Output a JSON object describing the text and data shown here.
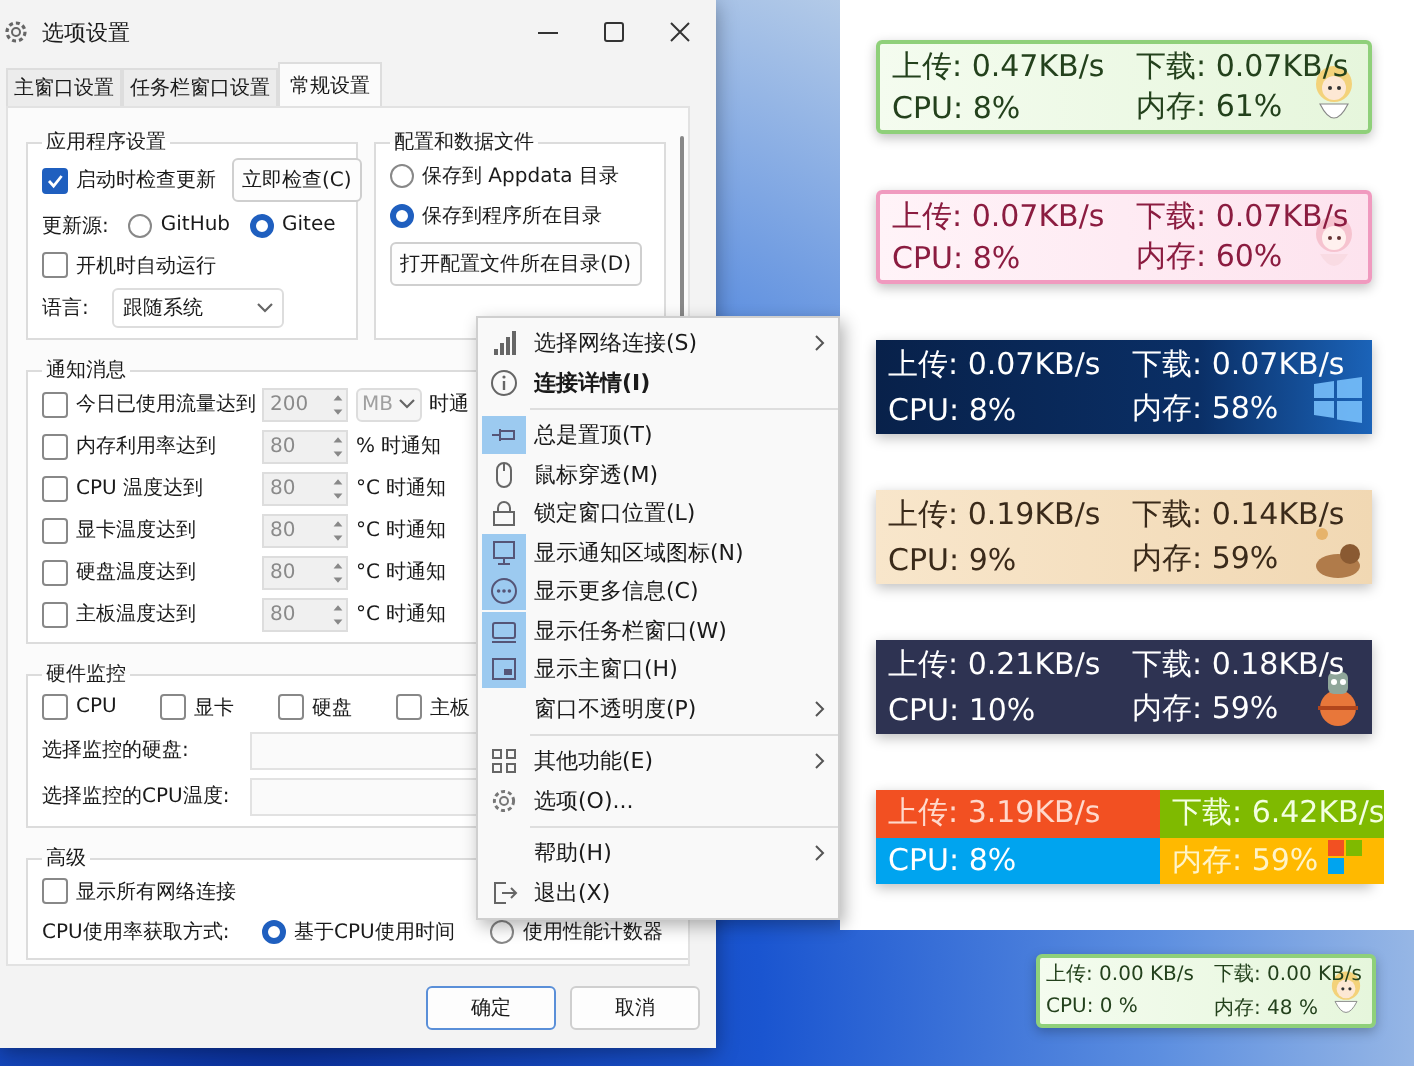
{
  "dialog": {
    "title": "选项设置",
    "tabs": [
      {
        "label": "主窗口设置",
        "selected": false
      },
      {
        "label": "任务栏窗口设置",
        "selected": false
      },
      {
        "label": "常规设置",
        "selected": true
      }
    ],
    "app_settings": {
      "title": "应用程序设置",
      "check_update": {
        "label": "启动时检查更新",
        "checked": true
      },
      "check_now_button": "立即检查(C)",
      "update_source": {
        "label": "更新源:",
        "options": [
          {
            "label": "GitHub",
            "selected": false
          },
          {
            "label": "Gitee",
            "selected": true
          }
        ]
      },
      "autostart": {
        "label": "开机时自动运行",
        "checked": false
      },
      "language": {
        "label": "语言:",
        "value": "跟随系统"
      }
    },
    "config_files": {
      "title": "配置和数据文件",
      "options": [
        {
          "label": "保存到 Appdata 目录",
          "selected": false
        },
        {
          "label": "保存到程序所在目录",
          "selected": true
        }
      ],
      "open_button": "打开配置文件所在目录(D)"
    },
    "notifications": {
      "title": "通知消息",
      "rows": [
        {
          "kind": "dropdown",
          "label": "今日已使用流量达到",
          "checked": false,
          "value": "200",
          "unit": "MB",
          "suffix": "时通"
        },
        {
          "kind": "text",
          "label": "内存利用率达到",
          "checked": false,
          "value": "80",
          "unit": "%",
          "suffix": "时通知"
        },
        {
          "kind": "text",
          "label": "CPU 温度达到",
          "checked": false,
          "value": "80",
          "unit": "°C",
          "suffix": "时通知"
        },
        {
          "kind": "text",
          "label": "显卡温度达到",
          "checked": false,
          "value": "80",
          "unit": "°C",
          "suffix": "时通知"
        },
        {
          "kind": "text",
          "label": "硬盘温度达到",
          "checked": false,
          "value": "80",
          "unit": "°C",
          "suffix": "时通知"
        },
        {
          "kind": "text",
          "label": "主板温度达到",
          "checked": false,
          "value": "80",
          "unit": "°C",
          "suffix": "时通知"
        }
      ]
    },
    "hardware": {
      "title": "硬件监控",
      "items": [
        {
          "label": "CPU",
          "checked": false
        },
        {
          "label": "显卡",
          "checked": false
        },
        {
          "label": "硬盘",
          "checked": false
        },
        {
          "label": "主板",
          "checked": false
        }
      ],
      "fields": [
        {
          "label": "选择监控的硬盘:"
        },
        {
          "label": "选择监控的CPU温度:"
        }
      ]
    },
    "advanced": {
      "title": "高级",
      "show_all": {
        "label": "显示所有网络连接",
        "checked": false
      },
      "cpu_method": {
        "label": "CPU使用率获取方式:",
        "options": [
          {
            "label": "基于CPU使用时间",
            "selected": true
          },
          {
            "label": "使用性能计数器",
            "selected": false
          }
        ]
      }
    },
    "buttons": [
      "确定",
      "取消"
    ]
  },
  "context_menu": {
    "items": [
      {
        "kind": "item",
        "label": "选择网络连接(S)",
        "checked": false,
        "bold": false,
        "submenu": true
      },
      {
        "kind": "item",
        "label": "连接详情(I)",
        "checked": false,
        "bold": true,
        "submenu": false
      },
      {
        "kind": "separator"
      },
      {
        "kind": "item",
        "label": "总是置顶(T)",
        "checked": true,
        "bold": false,
        "submenu": false
      },
      {
        "kind": "item",
        "label": "鼠标穿透(M)",
        "checked": false,
        "bold": false,
        "submenu": false
      },
      {
        "kind": "item",
        "label": "锁定窗口位置(L)",
        "checked": false,
        "bold": false,
        "submenu": false
      },
      {
        "kind": "item",
        "label": "显示通知区域图标(N)",
        "checked": true,
        "bold": false,
        "submenu": false
      },
      {
        "kind": "item",
        "label": "显示更多信息(C)",
        "checked": true,
        "bold": false,
        "submenu": false
      },
      {
        "kind": "item",
        "label": "显示任务栏窗口(W)",
        "checked": true,
        "bold": false,
        "submenu": false
      },
      {
        "kind": "item",
        "label": "显示主窗口(H)",
        "checked": true,
        "bold": false,
        "submenu": false
      },
      {
        "kind": "item",
        "label": "窗口不透明度(P)",
        "checked": false,
        "bold": false,
        "submenu": true
      },
      {
        "kind": "separator"
      },
      {
        "kind": "item",
        "label": "其他功能(E)",
        "checked": false,
        "bold": false,
        "submenu": true
      },
      {
        "kind": "item",
        "label": "选项(O)...",
        "checked": false,
        "bold": false,
        "submenu": false
      },
      {
        "kind": "separator"
      },
      {
        "kind": "item",
        "label": "帮助(H)",
        "checked": false,
        "bold": false,
        "submenu": true
      },
      {
        "kind": "item",
        "label": "退出(X)",
        "checked": false,
        "bold": false,
        "submenu": false
      }
    ]
  },
  "skins": [
    {
      "kind": "green",
      "upload": "上传: 0.47KB/s",
      "download": "下载: 0.07KB/s",
      "cpu": "CPU: 8%",
      "memory": "内存: 61%"
    },
    {
      "kind": "pink",
      "upload": "上传: 0.07KB/s",
      "download": "下载: 0.07KB/s",
      "cpu": "CPU: 8%",
      "memory": "内存: 60%"
    },
    {
      "kind": "navy",
      "upload": "上传: 0.07KB/s",
      "download": "下载: 0.07KB/s",
      "cpu": "CPU: 8%",
      "memory": "内存: 58%"
    },
    {
      "kind": "parchment",
      "upload": "上传: 0.19KB/s",
      "download": "下载: 0.14KB/s",
      "cpu": "CPU: 9%",
      "memory": "内存: 59%"
    },
    {
      "kind": "space",
      "upload": "上传: 0.21KB/s",
      "download": "下载: 0.18KB/s",
      "cpu": "CPU: 10%",
      "memory": "内存: 59%"
    },
    {
      "kind": "tiles",
      "upload": "上传: 3.19KB/s",
      "download": "下载: 6.42KB/s",
      "cpu": "CPU: 8%",
      "memory": "内存: 59%"
    }
  ],
  "taskbar_widget": {
    "kind": "green",
    "upload": "上传: 0.00 KB/s",
    "download": "下载: 0.00 KB/s",
    "cpu": "CPU: 0 %",
    "memory": "内存: 48 %"
  }
}
